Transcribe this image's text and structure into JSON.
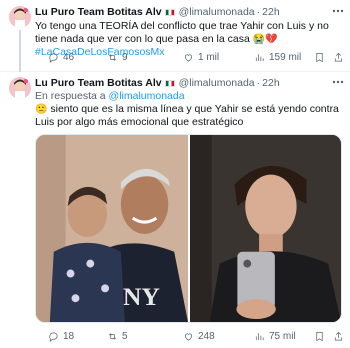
{
  "tweets": [
    {
      "author_name": "Lu Puro Team Botitas Alv",
      "handle": "@limalumonada",
      "separator": "·",
      "time": "22h",
      "text_plain": "Yo tengo una TEORÍA del conflicto que trae Yahir con Luis y no tiene nada que ver con lo que pasa en la casa ",
      "text_emoji": "😭💔",
      "hashtag": "#LaCasaDeLosFamososMx",
      "stats": {
        "replies": "46",
        "retweets": "9",
        "likes": "1 mil",
        "views": "159 mil"
      }
    },
    {
      "author_name": "Lu Puro Team Botitas Alv",
      "handle": "@limalumonada",
      "separator": "·",
      "time": "22h",
      "reply_prefix": "En respuesta a ",
      "reply_mention": "@limalumonada",
      "text_emoji": "🙁",
      "text_plain": " siento que es la misma línea y que Yahir se está yendo contra Luis por algo más emocional que estratégico",
      "stats": {
        "replies": "18",
        "retweets": "5",
        "likes": "248",
        "views": "75 mil"
      }
    }
  ],
  "icons": {
    "reply": "reply-icon",
    "retweet": "retweet-icon",
    "like": "heart-icon",
    "views": "views-chart-icon",
    "bookmark": "bookmark-icon",
    "share": "share-icon",
    "more": "more-options-icon",
    "flag": "mexico-flag-icon"
  },
  "colors": {
    "link": "#1d9bf0",
    "secondary_text": "#536471",
    "primary_text": "#0f1419",
    "divider": "#eff3f4"
  }
}
